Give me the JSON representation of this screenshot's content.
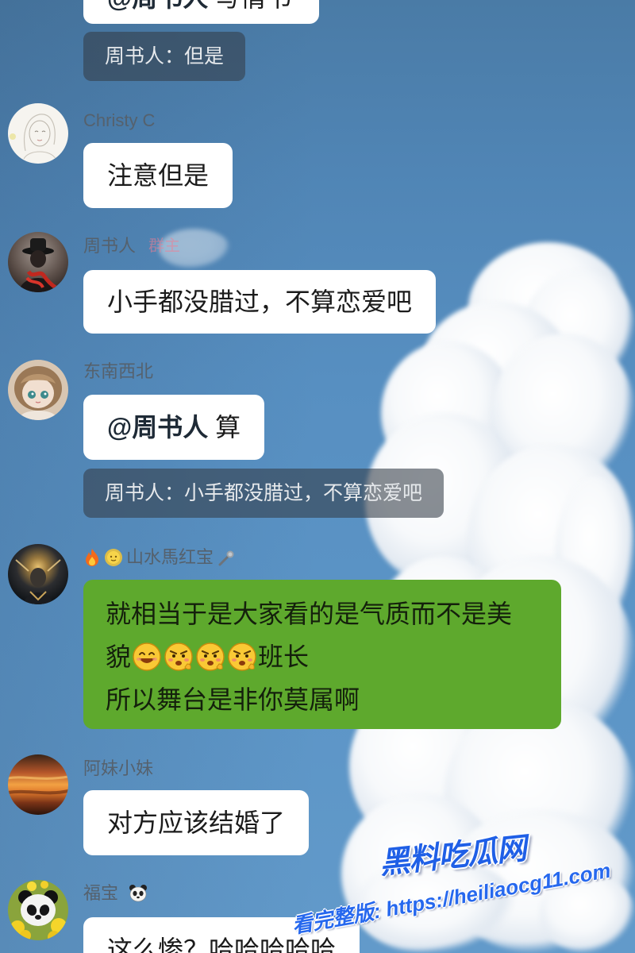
{
  "theme": {
    "bubble_color": "#ffffff",
    "self_bubble_color": "#5ea92d",
    "quote_background": "rgba(52,60,70,0.58)",
    "owner_badge_color": "#f27e93",
    "watermark_color": "#1f5fe6"
  },
  "partial_message": {
    "mention": "@周书人",
    "text": "写情书"
  },
  "partial_quote": "周书人：但是",
  "messages": [
    {
      "sender": "Christy C",
      "avatar": "sketch-girl-avatar",
      "text": "注意但是"
    },
    {
      "sender": "周书人",
      "badge": "群主",
      "avatar": "hat-figure-avatar",
      "text": "小手都没腊过，不算恋爱吧"
    },
    {
      "sender": "东南西北",
      "avatar": "doll-avatar",
      "mention": "@周书人",
      "text": "算",
      "quote": "周书人：小手都没腊过，不算恋爱吧"
    },
    {
      "sender": "山水馬红宝",
      "sender_icons_before": [
        "fire-icon",
        "sun-face-icon"
      ],
      "sender_icons_after": [
        "microphone-icon"
      ],
      "avatar": "golden-glow-avatar",
      "line1": "就相当于是大家看的是气质而不是美",
      "line2_start": "貌",
      "line2_emojis": [
        "smiling-face-emoji",
        "struggle-emoji",
        "struggle-emoji",
        "struggle-emoji"
      ],
      "line2_end": "班长",
      "line3": "所以舞台是非你莫属啊"
    },
    {
      "sender": "阿妹小妹",
      "avatar": "sunset-avatar",
      "text": "对方应该结婚了"
    },
    {
      "sender": "福宝",
      "sender_icons_after": [
        "panda-icon"
      ],
      "avatar": "panda-avatar",
      "text": "这么惨？哈哈哈哈哈"
    }
  ],
  "watermark": {
    "brand": "黑料吃瓜网",
    "cta": "看完整版: https://heiliaocg11.com"
  }
}
